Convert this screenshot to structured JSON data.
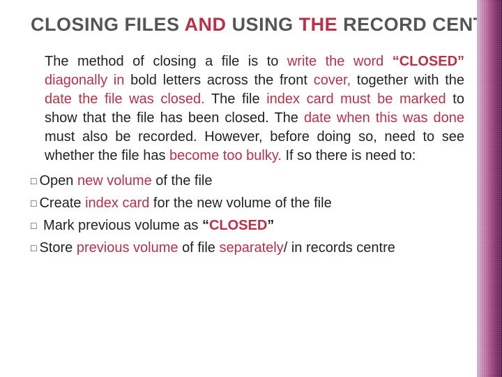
{
  "title": {
    "words": [
      {
        "t": "CLOSING",
        "red": false
      },
      {
        "t": "FILES",
        "red": false
      },
      {
        "t": "AND",
        "red": true
      },
      {
        "t": "USING",
        "red": false
      },
      {
        "t": "THE",
        "red": true
      },
      {
        "t": "RECORD",
        "red": false
      },
      {
        "t": "CENTRE",
        "red": false
      }
    ]
  },
  "para_words": [
    {
      "t": "The",
      "red": false,
      "b": false
    },
    {
      "t": "method",
      "red": false,
      "b": false
    },
    {
      "t": "of",
      "red": false,
      "b": false
    },
    {
      "t": "closing",
      "red": false,
      "b": false
    },
    {
      "t": "a",
      "red": false,
      "b": false
    },
    {
      "t": "file",
      "red": false,
      "b": false
    },
    {
      "t": "is",
      "red": false,
      "b": false
    },
    {
      "t": "to",
      "red": false,
      "b": false
    },
    {
      "t": "write",
      "red": true,
      "b": false
    },
    {
      "t": "the",
      "red": true,
      "b": false
    },
    {
      "t": "word",
      "red": true,
      "b": false
    },
    {
      "t": "“CLOSED”",
      "red": true,
      "b": true
    },
    {
      "t": "diagonally",
      "red": true,
      "b": false
    },
    {
      "t": "in",
      "red": true,
      "b": false
    },
    {
      "t": "bold",
      "red": false,
      "b": false
    },
    {
      "t": "letters",
      "red": false,
      "b": false
    },
    {
      "t": "across",
      "red": false,
      "b": false
    },
    {
      "t": "the",
      "red": false,
      "b": false
    },
    {
      "t": "front",
      "red": false,
      "b": false
    },
    {
      "t": "cover,",
      "red": true,
      "b": false
    },
    {
      "t": "together",
      "red": false,
      "b": false
    },
    {
      "t": "with",
      "red": false,
      "b": false
    },
    {
      "t": "the",
      "red": false,
      "b": false
    },
    {
      "t": "date",
      "red": true,
      "b": false
    },
    {
      "t": "the",
      "red": true,
      "b": false
    },
    {
      "t": "file",
      "red": true,
      "b": false
    },
    {
      "t": "was",
      "red": true,
      "b": false
    },
    {
      "t": "closed.",
      "red": true,
      "b": false
    },
    {
      "t": "The",
      "red": false,
      "b": false
    },
    {
      "t": "file",
      "red": false,
      "b": false
    },
    {
      "t": "index",
      "red": true,
      "b": false
    },
    {
      "t": "card",
      "red": true,
      "b": false
    },
    {
      "t": "must",
      "red": true,
      "b": false
    },
    {
      "t": "be",
      "red": true,
      "b": false
    },
    {
      "t": "marked",
      "red": true,
      "b": false
    },
    {
      "t": "to",
      "red": false,
      "b": false
    },
    {
      "t": "show",
      "red": false,
      "b": false
    },
    {
      "t": "that",
      "red": false,
      "b": false
    },
    {
      "t": "the",
      "red": false,
      "b": false
    },
    {
      "t": "file",
      "red": false,
      "b": false
    },
    {
      "t": "has",
      "red": false,
      "b": false
    },
    {
      "t": "been",
      "red": false,
      "b": false
    },
    {
      "t": "closed.",
      "red": false,
      "b": false
    },
    {
      "t": "The",
      "red": false,
      "b": false
    },
    {
      "t": "date",
      "red": true,
      "b": false
    },
    {
      "t": "when",
      "red": true,
      "b": false
    },
    {
      "t": "this",
      "red": true,
      "b": false
    },
    {
      "t": "was",
      "red": true,
      "b": false
    },
    {
      "t": "done",
      "red": true,
      "b": false
    },
    {
      "t": "must",
      "red": false,
      "b": false
    },
    {
      "t": "also",
      "red": false,
      "b": false
    },
    {
      "t": "be",
      "red": false,
      "b": false
    },
    {
      "t": "recorded.",
      "red": false,
      "b": false
    },
    {
      "t": "However,",
      "red": false,
      "b": false
    },
    {
      "t": "before",
      "red": false,
      "b": false
    },
    {
      "t": "doing",
      "red": false,
      "b": false
    },
    {
      "t": "so,",
      "red": false,
      "b": false
    },
    {
      "t": "need",
      "red": false,
      "b": false
    },
    {
      "t": "to",
      "red": false,
      "b": false
    },
    {
      "t": "see",
      "red": false,
      "b": false
    },
    {
      "t": "whether",
      "red": false,
      "b": false
    },
    {
      "t": "the",
      "red": false,
      "b": false
    },
    {
      "t": "file",
      "red": false,
      "b": false
    },
    {
      "t": "has",
      "red": false,
      "b": false
    },
    {
      "t": "become",
      "red": true,
      "b": false
    },
    {
      "t": "too",
      "red": true,
      "b": false
    },
    {
      "t": "bulky.",
      "red": true,
      "b": false
    },
    {
      "t": "If",
      "red": false,
      "b": false
    },
    {
      "t": "so",
      "red": false,
      "b": false
    },
    {
      "t": "there",
      "red": false,
      "b": false
    },
    {
      "t": "is",
      "red": false,
      "b": false
    },
    {
      "t": "need",
      "red": false,
      "b": false
    },
    {
      "t": "to:",
      "red": false,
      "b": false
    }
  ],
  "bullets": [
    {
      "has_box": true,
      "words": [
        {
          "t": "Open",
          "red": false,
          "b": false
        },
        {
          "t": "new",
          "red": true,
          "b": false
        },
        {
          "t": "volume",
          "red": true,
          "b": false
        },
        {
          "t": "of",
          "red": false,
          "b": false
        },
        {
          "t": "the",
          "red": false,
          "b": false
        },
        {
          "t": "file",
          "red": false,
          "b": false
        }
      ]
    },
    {
      "has_box": true,
      "words": [
        {
          "t": "Create",
          "red": false,
          "b": false
        },
        {
          "t": "index",
          "red": true,
          "b": false
        },
        {
          "t": "card",
          "red": true,
          "b": false
        },
        {
          "t": "for",
          "red": false,
          "b": false
        },
        {
          "t": "the",
          "red": false,
          "b": false
        },
        {
          "t": "new",
          "red": false,
          "b": false
        },
        {
          "t": "volume",
          "red": false,
          "b": false
        },
        {
          "t": "of",
          "red": false,
          "b": false
        },
        {
          "t": "the",
          "red": false,
          "b": false
        },
        {
          "t": "file",
          "red": false,
          "b": false
        }
      ]
    },
    {
      "has_box": true,
      "leading_space": true,
      "words": [
        {
          "t": "Mark",
          "red": false,
          "b": false
        },
        {
          "t": "previous",
          "red": false,
          "b": false
        },
        {
          "t": "volume",
          "red": false,
          "b": false
        },
        {
          "t": "as",
          "red": false,
          "b": false
        },
        {
          "t": "“",
          "red": false,
          "b": true
        },
        {
          "t": "CLOSED",
          "red": true,
          "b": true,
          "nospace_before": true
        },
        {
          "t": "”",
          "red": false,
          "b": true,
          "nospace_before": true
        }
      ]
    },
    {
      "has_box": true,
      "words": [
        {
          "t": "Store",
          "red": false,
          "b": false
        },
        {
          "t": "previous",
          "red": true,
          "b": false
        },
        {
          "t": "volume",
          "red": true,
          "b": false
        },
        {
          "t": "of",
          "red": false,
          "b": false
        },
        {
          "t": "file",
          "red": false,
          "b": false
        },
        {
          "t": "separately",
          "red": true,
          "b": false
        },
        {
          "t": "/",
          "red": false,
          "b": false,
          "nospace_before": true
        },
        {
          "t": "in",
          "red": false,
          "b": false
        },
        {
          "t": "records",
          "red": false,
          "b": false
        },
        {
          "t": "centre",
          "red": false,
          "b": false
        }
      ]
    }
  ],
  "glyphs": {
    "checkbox": "□"
  }
}
